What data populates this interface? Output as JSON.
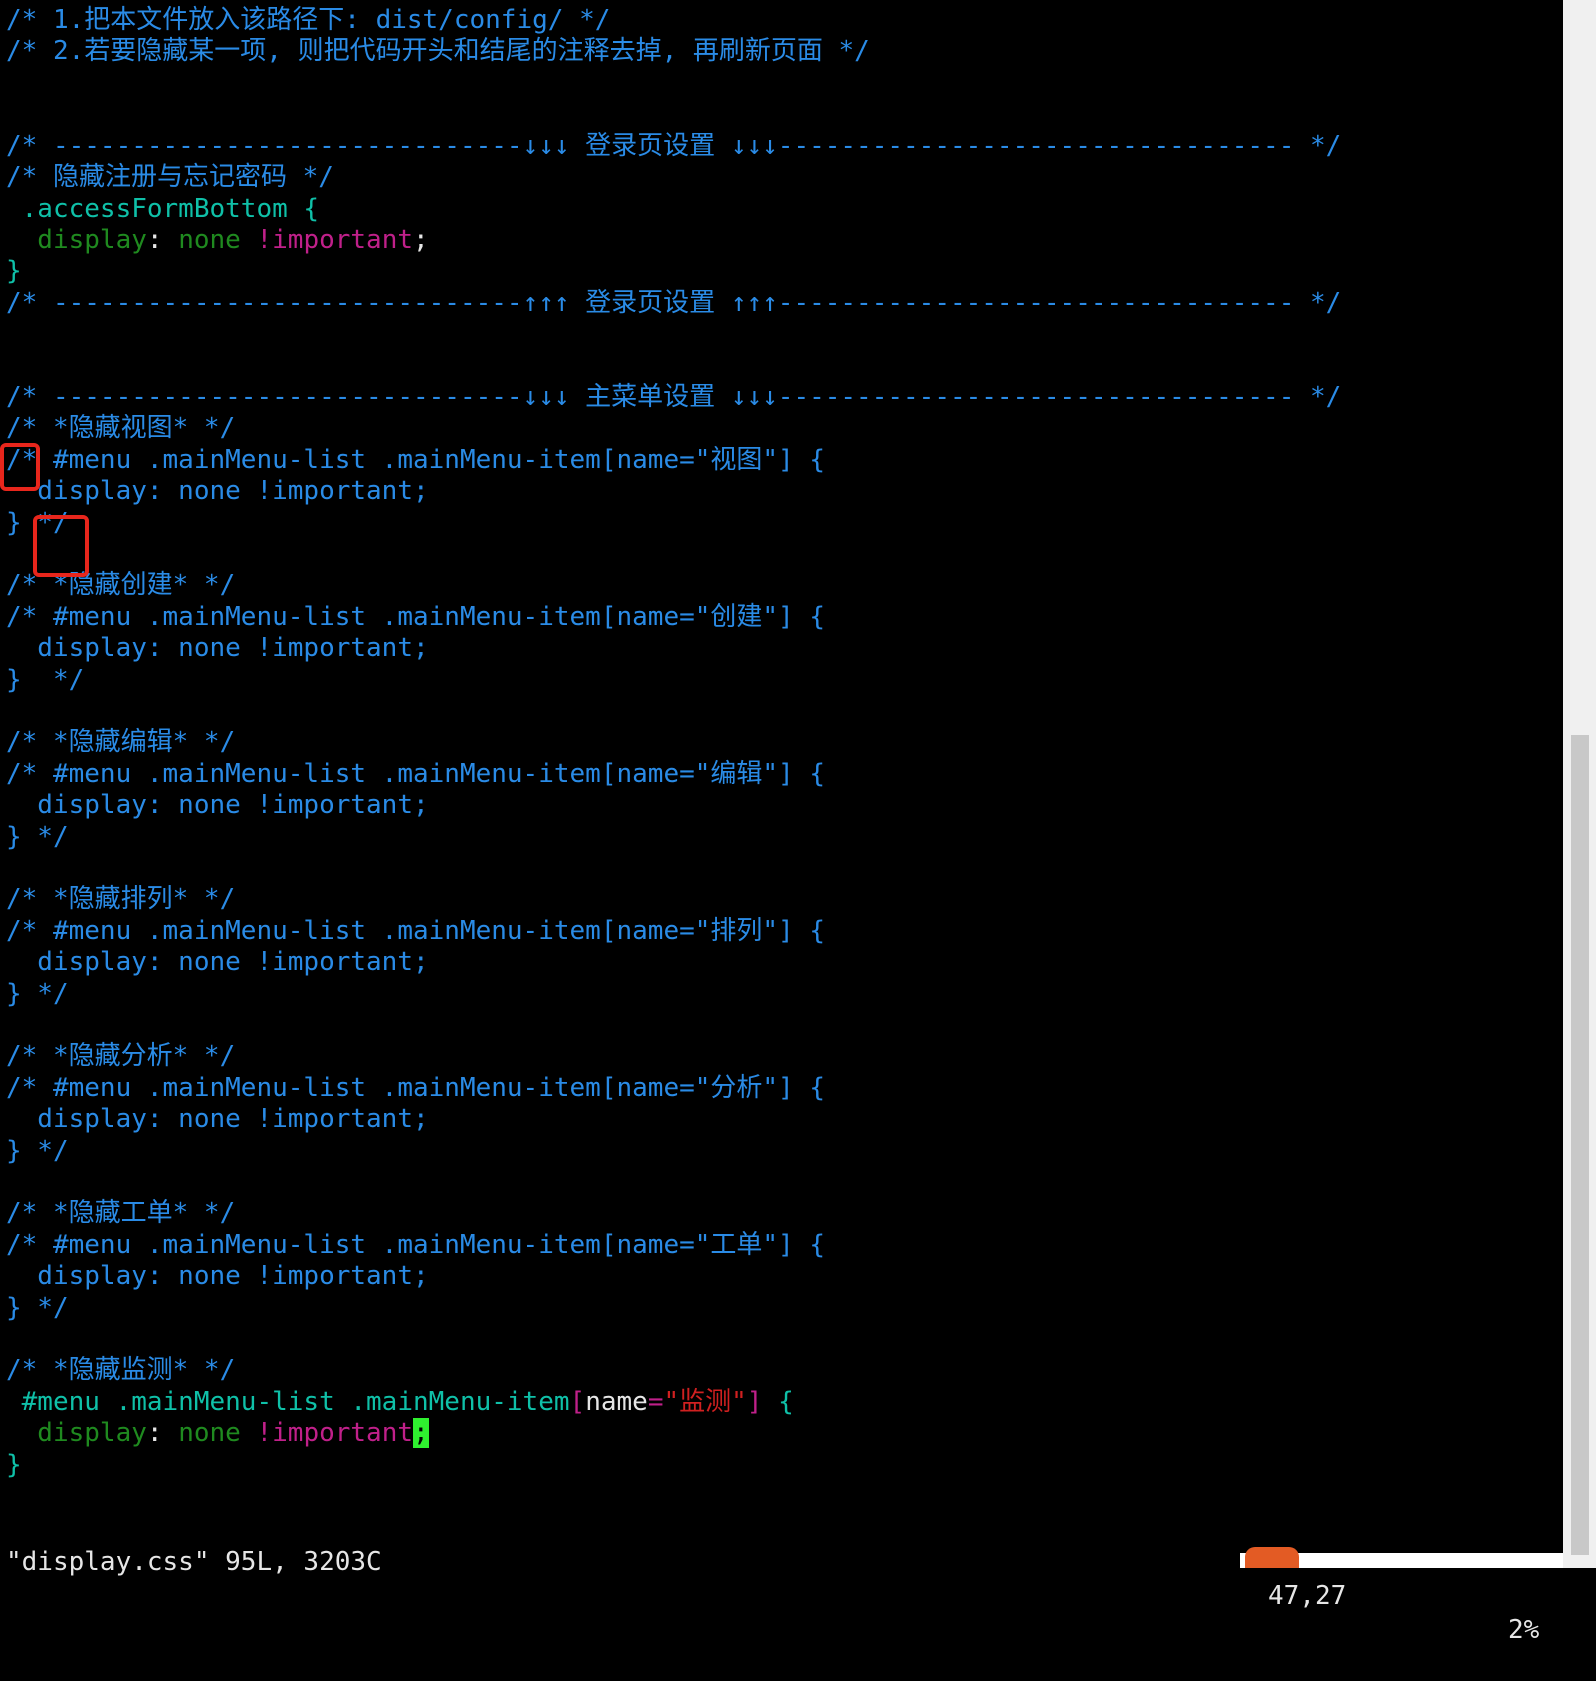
{
  "editor": {
    "lines": {
      "l1": "/* 1.把本文件放入该路径下: dist/config/ */",
      "l2": "/* 2.若要隐藏某一项, 则把代码开头和结尾的注释去掉, 再刷新页面 */",
      "l3": "/* ------------------------------↓↓↓ 登录页设置 ↓↓↓--------------------------------- */",
      "l4": "/* 隐藏注册与忘记密码 */",
      "l5_sel": " .accessFormBottom {",
      "l6_prop": "  display",
      "l6_colon": ": ",
      "l6_val": "none ",
      "l6_imp": "!important",
      "l6_semi": ";",
      "l7": "}",
      "l8": "/* ------------------------------↑↑↑ 登录页设置 ↑↑↑--------------------------------- */",
      "l9": "/* ------------------------------↓↓↓ 主菜单设置 ↓↓↓--------------------------------- */",
      "l10": "/* *隐藏视图* */",
      "l11": "/* #menu .mainMenu-list .mainMenu-item[name=\"视图\"] {",
      "l12": "  display: none !important;",
      "l13": "} */",
      "l14": "/* *隐藏创建* */",
      "l15": "/* #menu .mainMenu-list .mainMenu-item[name=\"创建\"] {",
      "l16": "  display: none !important;",
      "l17": "}  */",
      "l18": "/* *隐藏编辑* */",
      "l19": "/* #menu .mainMenu-list .mainMenu-item[name=\"编辑\"] {",
      "l20": "  display: none !important;",
      "l21": "} */",
      "l22": "/* *隐藏排列* */",
      "l23": "/* #menu .mainMenu-list .mainMenu-item[name=\"排列\"] {",
      "l24": "  display: none !important;",
      "l25": "} */",
      "l26": "/* *隐藏分析* */",
      "l27": "/* #menu .mainMenu-list .mainMenu-item[name=\"分析\"] {",
      "l28": "  display: none !important;",
      "l29": "} */",
      "l30": "/* *隐藏工单* */",
      "l31": "/* #menu .mainMenu-list .mainMenu-item[name=\"工单\"] {",
      "l32": "  display: none !important;",
      "l33": "} */",
      "l34": "/* *隐藏监测* */",
      "l35_sel": " #menu .mainMenu-list .mainMenu-item",
      "l35_lb": "[",
      "l35_attr": "name",
      "l35_eq": "=",
      "l35_str": "\"监测\"",
      "l35_rb": "]",
      "l35_brace": " {",
      "l36_prop": "  display",
      "l36_colon": ": ",
      "l36_val": "none ",
      "l36_imp": "!important",
      "l36_cursor": ";",
      "l37": "}"
    }
  },
  "status": {
    "file": "\"display.css\" 95L, 3203C",
    "position": "47,27",
    "percent": "2%"
  },
  "colors": {
    "background": "#000000",
    "comment": "#2a8be6",
    "selector": "#0fc0a8",
    "property": "#1f8a1f",
    "important": "#c0208a",
    "string": "#d02020",
    "cursor": "#2ff02f",
    "highlight_box": "#e8261c"
  }
}
